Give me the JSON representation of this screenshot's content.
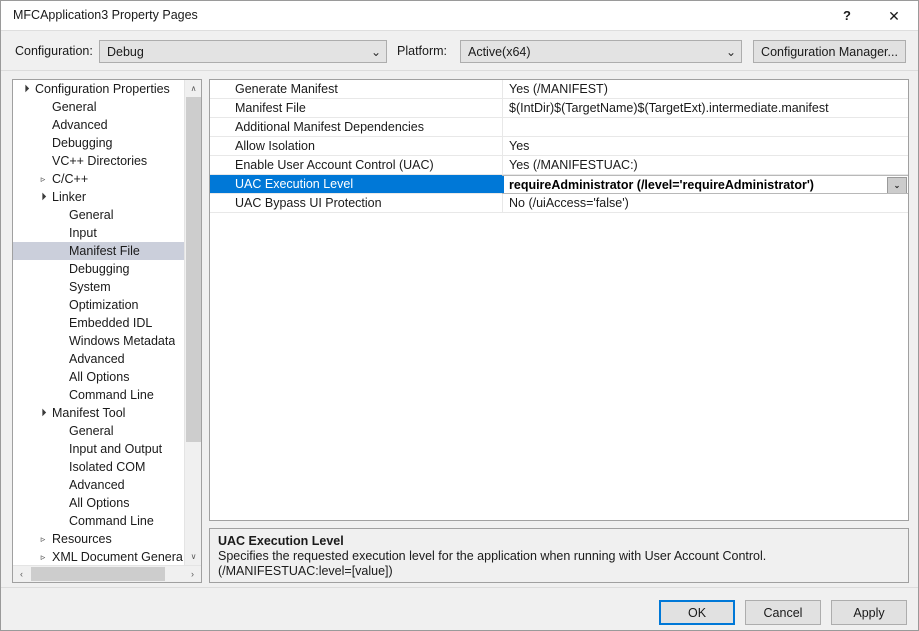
{
  "window": {
    "title": "MFCApplication3 Property Pages",
    "help_glyph": "?",
    "close_glyph": "✕"
  },
  "configbar": {
    "configuration_label": "Configuration:",
    "configuration_value": "Debug",
    "platform_label": "Platform:",
    "platform_value": "Active(x64)",
    "config_manager_label": "Configuration Manager...",
    "arrow_glyph": "⌄"
  },
  "tree": {
    "items": [
      {
        "label": "Configuration Properties",
        "indent": 0,
        "expander": "expanded",
        "selected": false
      },
      {
        "label": "General",
        "indent": 1,
        "expander": "none",
        "selected": false
      },
      {
        "label": "Advanced",
        "indent": 1,
        "expander": "none",
        "selected": false
      },
      {
        "label": "Debugging",
        "indent": 1,
        "expander": "none",
        "selected": false
      },
      {
        "label": "VC++ Directories",
        "indent": 1,
        "expander": "none",
        "selected": false
      },
      {
        "label": "C/C++",
        "indent": 1,
        "expander": "collapsed",
        "selected": false
      },
      {
        "label": "Linker",
        "indent": 1,
        "expander": "expanded",
        "selected": false
      },
      {
        "label": "General",
        "indent": 2,
        "expander": "none",
        "selected": false
      },
      {
        "label": "Input",
        "indent": 2,
        "expander": "none",
        "selected": false
      },
      {
        "label": "Manifest File",
        "indent": 2,
        "expander": "none",
        "selected": true
      },
      {
        "label": "Debugging",
        "indent": 2,
        "expander": "none",
        "selected": false
      },
      {
        "label": "System",
        "indent": 2,
        "expander": "none",
        "selected": false
      },
      {
        "label": "Optimization",
        "indent": 2,
        "expander": "none",
        "selected": false
      },
      {
        "label": "Embedded IDL",
        "indent": 2,
        "expander": "none",
        "selected": false
      },
      {
        "label": "Windows Metadata",
        "indent": 2,
        "expander": "none",
        "selected": false
      },
      {
        "label": "Advanced",
        "indent": 2,
        "expander": "none",
        "selected": false
      },
      {
        "label": "All Options",
        "indent": 2,
        "expander": "none",
        "selected": false
      },
      {
        "label": "Command Line",
        "indent": 2,
        "expander": "none",
        "selected": false
      },
      {
        "label": "Manifest Tool",
        "indent": 1,
        "expander": "expanded",
        "selected": false
      },
      {
        "label": "General",
        "indent": 2,
        "expander": "none",
        "selected": false
      },
      {
        "label": "Input and Output",
        "indent": 2,
        "expander": "none",
        "selected": false
      },
      {
        "label": "Isolated COM",
        "indent": 2,
        "expander": "none",
        "selected": false
      },
      {
        "label": "Advanced",
        "indent": 2,
        "expander": "none",
        "selected": false
      },
      {
        "label": "All Options",
        "indent": 2,
        "expander": "none",
        "selected": false
      },
      {
        "label": "Command Line",
        "indent": 2,
        "expander": "none",
        "selected": false
      },
      {
        "label": "Resources",
        "indent": 1,
        "expander": "collapsed",
        "selected": false
      },
      {
        "label": "XML Document Genera",
        "indent": 1,
        "expander": "collapsed",
        "selected": false
      }
    ],
    "scroll_up_glyph": "∧",
    "scroll_down_glyph": "∨",
    "scroll_left_glyph": "‹",
    "scroll_right_glyph": "›",
    "expander_collapsed_glyph": "▹",
    "expander_expanded_glyph": "◢"
  },
  "grid": {
    "rows": [
      {
        "name": "Generate Manifest",
        "value": "Yes (/MANIFEST)",
        "selected": false
      },
      {
        "name": "Manifest File",
        "value": "$(IntDir)$(TargetName)$(TargetExt).intermediate.manifest",
        "selected": false
      },
      {
        "name": "Additional Manifest Dependencies",
        "value": "",
        "selected": false
      },
      {
        "name": "Allow Isolation",
        "value": "Yes",
        "selected": false
      },
      {
        "name": "Enable User Account Control (UAC)",
        "value": "Yes (/MANIFESTUAC:)",
        "selected": false
      },
      {
        "name": "UAC Execution Level",
        "value": "requireAdministrator (/level='requireAdministrator')",
        "selected": true
      },
      {
        "name": "UAC Bypass UI Protection",
        "value": "No (/uiAccess='false')",
        "selected": false
      }
    ],
    "dropdown_glyph": "⌄"
  },
  "description": {
    "title": "UAC Execution Level",
    "line1": "Specifies the requested execution level for the application when running with User Account Control.",
    "line2": "(/MANIFESTUAC:level=[value])"
  },
  "footer": {
    "ok_label": "OK",
    "cancel_label": "Cancel",
    "apply_label": "Apply"
  },
  "colors": {
    "accent": "#0078d7",
    "dialog_bg": "#f0f0f0",
    "tree_selected": "#cbcfdb",
    "close_hover": "#e81123"
  }
}
